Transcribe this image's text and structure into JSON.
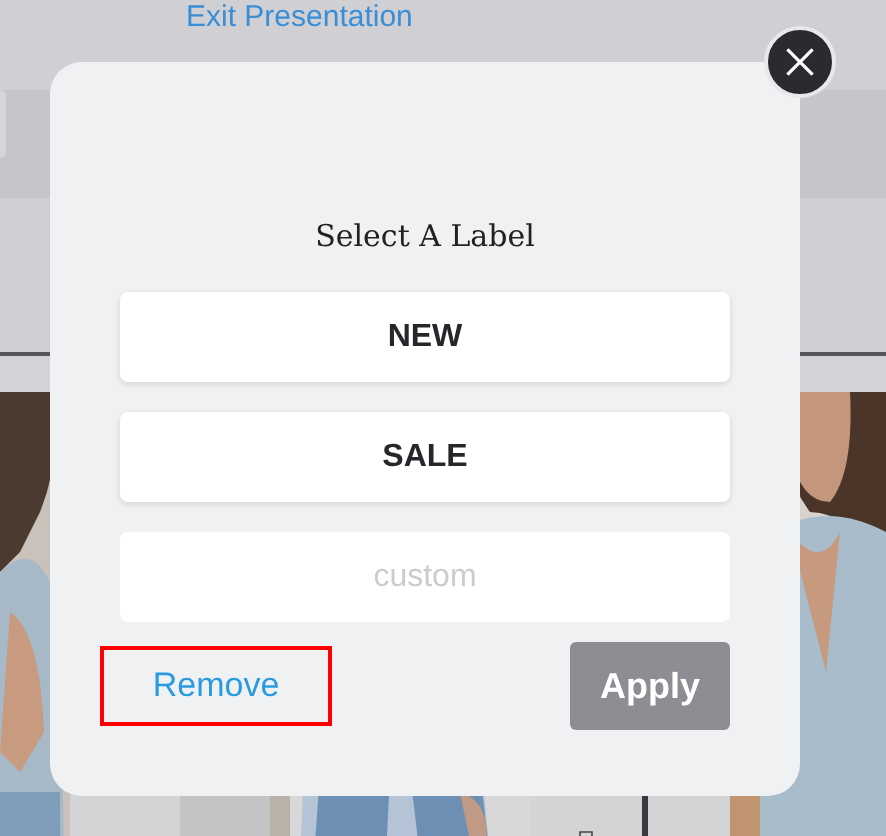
{
  "background": {
    "link": "Exit Presentation"
  },
  "dialog": {
    "title": "Select A Label",
    "options": [
      {
        "label": "NEW"
      },
      {
        "label": "SALE"
      }
    ],
    "custom_field": {
      "placeholder": "custom"
    },
    "remove_button": {
      "label": "Remove",
      "highlighted": true
    },
    "apply_button": {
      "label": "Apply",
      "disabled": true
    }
  }
}
